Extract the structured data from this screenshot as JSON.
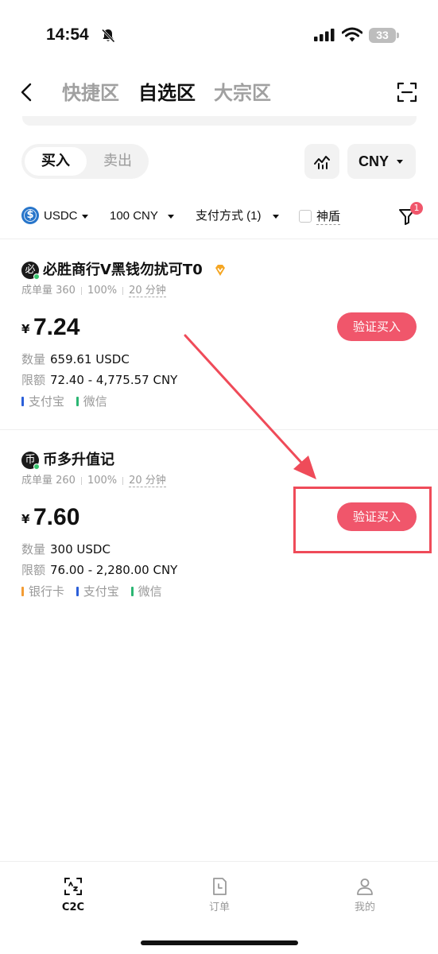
{
  "status_bar": {
    "time": "14:54",
    "battery": "33"
  },
  "header": {
    "tabs": [
      {
        "label": "快捷区",
        "active": false
      },
      {
        "label": "自选区",
        "active": true
      },
      {
        "label": "大宗区",
        "active": false
      }
    ]
  },
  "trade_toggle": {
    "buy": "买入",
    "sell": "卖出",
    "selected": "买入"
  },
  "currency": {
    "label": "CNY"
  },
  "filters": {
    "asset": "USDC",
    "amount": "100 CNY",
    "payment": "支付方式 (1)",
    "shield": "神盾",
    "shield_checked": false,
    "filter_badge": "1"
  },
  "listings": [
    {
      "avatar": "必",
      "name": "必胜商行V黑钱勿扰可T0",
      "verified_tag": true,
      "stats": {
        "orders": "成单量 360",
        "rate": "100%",
        "time": "20 分钟"
      },
      "currency_symbol": "¥",
      "price": "7.24",
      "quantity_label": "数量",
      "quantity": "659.61 USDC",
      "limit_label": "限额",
      "limit": "72.40 - 4,775.57 CNY",
      "payments": [
        {
          "name": "支付宝",
          "color": "#2b5fd9"
        },
        {
          "name": "微信",
          "color": "#2bb673"
        }
      ],
      "button": "验证买入"
    },
    {
      "avatar": "币",
      "name": "币多升值记",
      "verified_tag": false,
      "stats": {
        "orders": "成单量 260",
        "rate": "100%",
        "time": "20 分钟"
      },
      "currency_symbol": "¥",
      "price": "7.60",
      "quantity_label": "数量",
      "quantity": "300 USDC",
      "limit_label": "限额",
      "limit": "76.00 - 2,280.00 CNY",
      "payments": [
        {
          "name": "银行卡",
          "color": "#f39c34"
        },
        {
          "name": "支付宝",
          "color": "#2b5fd9"
        },
        {
          "name": "微信",
          "color": "#2bb673"
        }
      ],
      "button": "验证买入"
    }
  ],
  "bottom_nav": [
    {
      "label": "C2C",
      "icon": "c2c-icon",
      "active": true
    },
    {
      "label": "订单",
      "icon": "orders-icon",
      "active": false
    },
    {
      "label": "我的",
      "icon": "profile-icon",
      "active": false
    }
  ],
  "colors": {
    "accent": "#f0566b",
    "annotation": "#ef4b59",
    "muted": "#9a9a9a"
  }
}
